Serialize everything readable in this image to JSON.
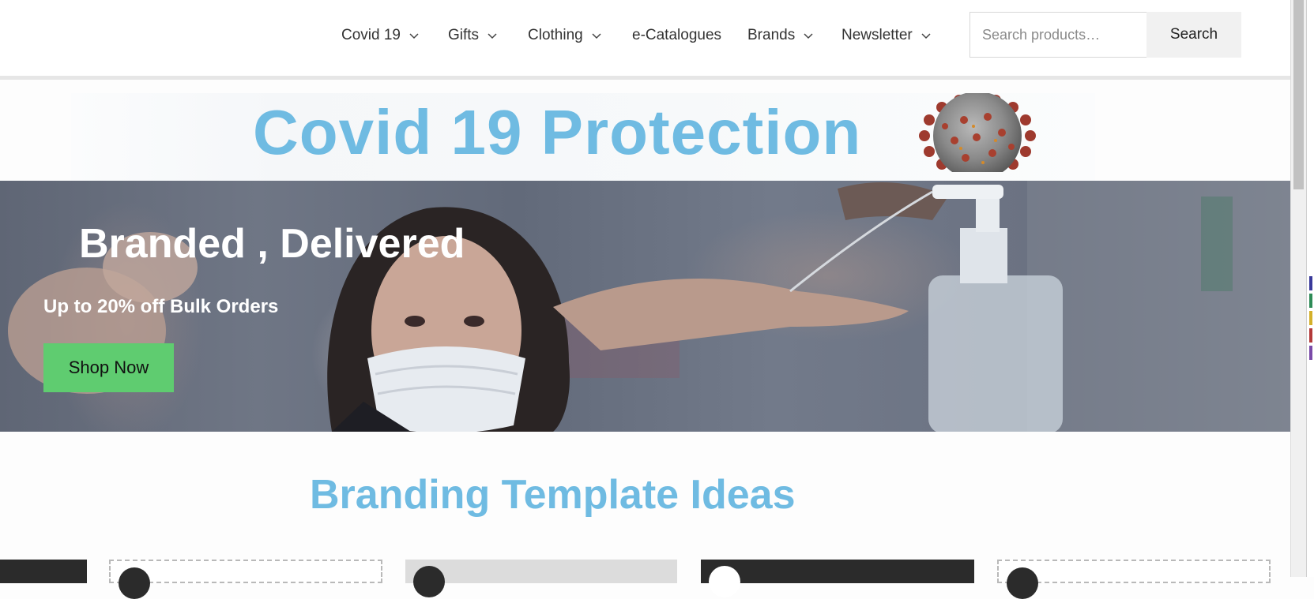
{
  "nav": {
    "items": [
      {
        "label": "Covid 19",
        "dropdown": true
      },
      {
        "label": "Gifts",
        "dropdown": true
      },
      {
        "label": "Clothing",
        "dropdown": true
      },
      {
        "label": "e-Catalogues",
        "dropdown": false
      },
      {
        "label": "Brands",
        "dropdown": true
      },
      {
        "label": "Newsletter",
        "dropdown": true
      }
    ]
  },
  "search": {
    "placeholder": "Search products…",
    "button_label": "Search"
  },
  "covid_banner": {
    "title": "Covid 19 Protection",
    "image_icon": "coronavirus-icon"
  },
  "hero": {
    "heading": "Branded , Delivered",
    "subheading": "Up to 20% off Bulk Orders",
    "cta_label": "Shop Now"
  },
  "section": {
    "title": "Branding Template Ideas"
  },
  "colors": {
    "accent_blue": "#6fbbe2",
    "cta_green": "#5fcc70",
    "nav_text": "#333333"
  }
}
